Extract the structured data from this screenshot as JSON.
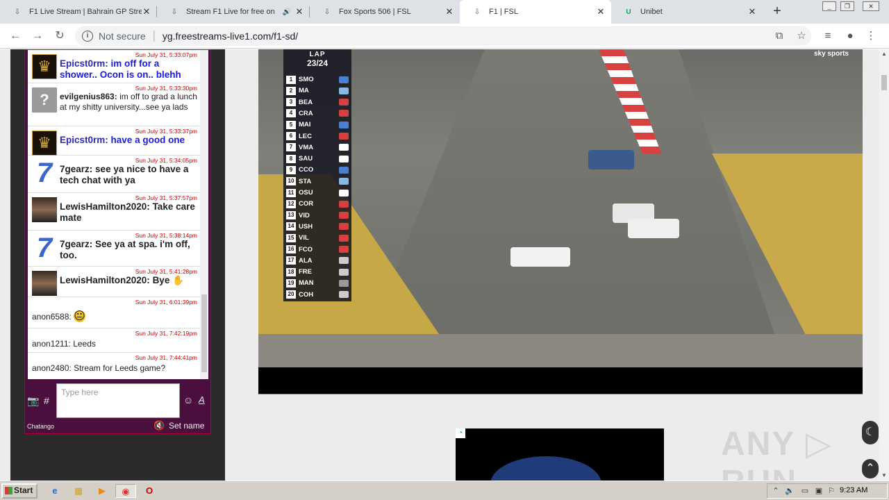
{
  "tabs": [
    {
      "title": "F1 Live Stream | Bahrain GP Stre",
      "icon": "page-icon",
      "active": false,
      "audio": false
    },
    {
      "title": "Stream F1 Live for free on",
      "icon": "page-icon",
      "active": false,
      "audio": true
    },
    {
      "title": "Fox Sports 506 | FSL",
      "icon": "page-icon",
      "active": false,
      "audio": false
    },
    {
      "title": "F1 | FSL",
      "icon": "page-icon",
      "active": true,
      "audio": false
    },
    {
      "title": "Unibet",
      "icon": "unibet-icon",
      "active": false,
      "audio": false
    }
  ],
  "address": {
    "security": "Not secure",
    "url": "yg.freestreams-live1.com/f1-sd/"
  },
  "chat": {
    "messages": [
      {
        "time": "Sun July 31, 5:33:07pm",
        "user": "Epicst0rm:",
        "text": "im off for a shower.. Ocon is on.. blehh",
        "style": "blue",
        "avatar": "crown"
      },
      {
        "time": "Sun July 31, 5:33:30pm",
        "user": "evilgenius863:",
        "text": "im off to grad a lunch at my shitty university...see ya lads",
        "style": "normal",
        "avatar": "question"
      },
      {
        "time": "Sun July 31, 5:33:37pm",
        "user": "Epicst0rm:",
        "text": "have a good one",
        "style": "blue",
        "avatar": "crown"
      },
      {
        "time": "Sun July 31, 5:34:05pm",
        "user": "7gearz:",
        "text": "see ya nice to have a tech chat with ya",
        "style": "big",
        "avatar": "seven"
      },
      {
        "time": "Sun July 31, 5:37:57pm",
        "user": "LewisHamilton2020:",
        "text": "Take care mate",
        "style": "big",
        "avatar": "face"
      },
      {
        "time": "Sun July 31, 5:38:14pm",
        "user": "7gearz:",
        "text": "See ya at spa. i'm off, too.",
        "style": "big",
        "avatar": "seven"
      },
      {
        "time": "Sun July 31, 5:41:28pm",
        "user": "LewisHamilton2020:",
        "text": "Bye ✋",
        "style": "big",
        "avatar": "face"
      },
      {
        "time": "Sun July 31, 6:01:39pm",
        "user": "anon6588:",
        "text": "😐",
        "style": "normal",
        "avatar": ""
      },
      {
        "time": "Sun July 31, 7:42:19pm",
        "user": "anon1211:",
        "text": "Leeds",
        "style": "normal",
        "avatar": ""
      },
      {
        "time": "Sun July 31, 7:44:41pm",
        "user": "anon2480:",
        "text": "Stream for Leeds game?",
        "style": "normal",
        "avatar": ""
      }
    ],
    "input_placeholder": "Type here",
    "brand": "Chatango",
    "set_name": "Set name"
  },
  "video": {
    "lap_label": "LAP",
    "lap": "23/24",
    "standings": [
      {
        "pos": "1",
        "code": "SMO",
        "team": "#4a7fd1"
      },
      {
        "pos": "2",
        "code": "MA",
        "team": "#8ab8e0"
      },
      {
        "pos": "3",
        "code": "BEA",
        "team": "#d64040"
      },
      {
        "pos": "4",
        "code": "CRA",
        "team": "#d64040"
      },
      {
        "pos": "5",
        "code": "MAI",
        "team": "#4a7fd1"
      },
      {
        "pos": "6",
        "code": "LEC",
        "team": "#d64040"
      },
      {
        "pos": "7",
        "code": "VMA",
        "team": "#ffffff"
      },
      {
        "pos": "8",
        "code": "SAU",
        "team": "#ffffff"
      },
      {
        "pos": "9",
        "code": "CCO",
        "team": "#4a7fd1"
      },
      {
        "pos": "10",
        "code": "STA",
        "team": "#8ab8e0"
      },
      {
        "pos": "11",
        "code": "OSU",
        "team": "#ffffff"
      },
      {
        "pos": "12",
        "code": "COR",
        "team": "#d64040"
      },
      {
        "pos": "13",
        "code": "VID",
        "team": "#d64040"
      },
      {
        "pos": "14",
        "code": "USH",
        "team": "#d64040"
      },
      {
        "pos": "15",
        "code": "VIL",
        "team": "#d64040"
      },
      {
        "pos": "16",
        "code": "FCO",
        "team": "#d64040"
      },
      {
        "pos": "17",
        "code": "ALA",
        "team": "#cccccc"
      },
      {
        "pos": "18",
        "code": "FRE",
        "team": "#cccccc"
      },
      {
        "pos": "19",
        "code": "MAN",
        "team": "#999999"
      },
      {
        "pos": "20",
        "code": "COH",
        "team": "#cccccc"
      }
    ],
    "broadcaster": "sky sports"
  },
  "watermark": "ANY ▷ RUN",
  "taskbar": {
    "start": "Start",
    "clock": "9:23 AM"
  }
}
